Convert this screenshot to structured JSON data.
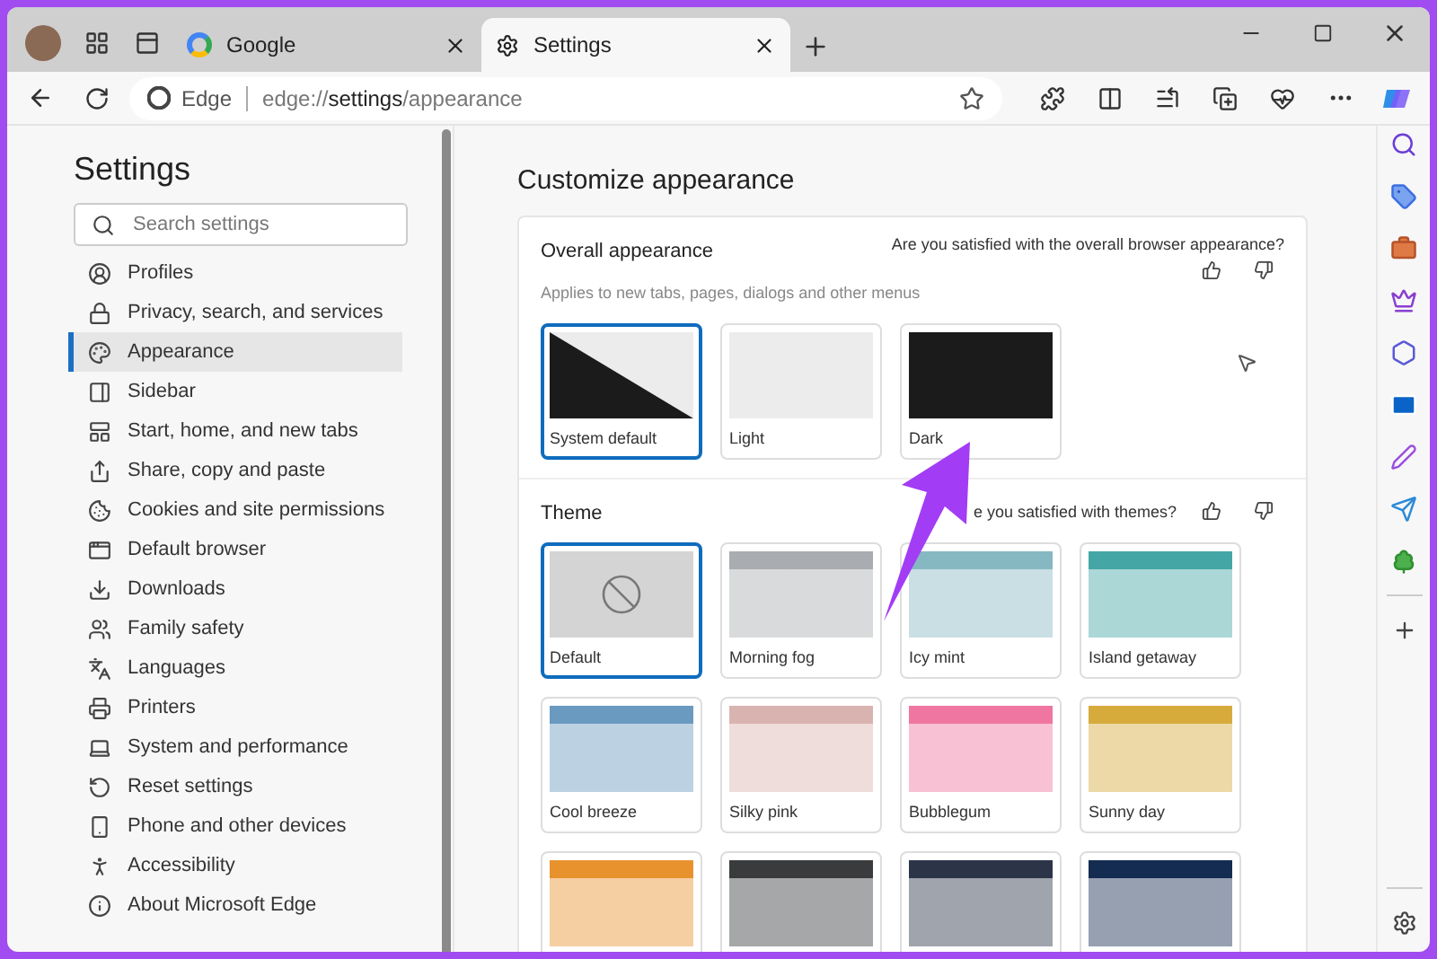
{
  "tabs": [
    {
      "label": "Google",
      "selected": false
    },
    {
      "label": "Settings",
      "selected": true
    }
  ],
  "address": {
    "site": "Edge",
    "url_prefix": "edge://",
    "url_main": "settings",
    "url_rest": "/appearance"
  },
  "sidebar": {
    "title": "Settings",
    "search": {
      "placeholder": "Search settings"
    },
    "items": [
      {
        "label": "Profiles",
        "selected": false
      },
      {
        "label": "Privacy, search, and services",
        "selected": false
      },
      {
        "label": "Appearance",
        "selected": true
      },
      {
        "label": "Sidebar",
        "selected": false
      },
      {
        "label": "Start, home, and new tabs",
        "selected": false
      },
      {
        "label": "Share, copy and paste",
        "selected": false
      },
      {
        "label": "Cookies and site permissions",
        "selected": false
      },
      {
        "label": "Default browser",
        "selected": false
      },
      {
        "label": "Downloads",
        "selected": false
      },
      {
        "label": "Family safety",
        "selected": false
      },
      {
        "label": "Languages",
        "selected": false
      },
      {
        "label": "Printers",
        "selected": false
      },
      {
        "label": "System and performance",
        "selected": false
      },
      {
        "label": "Reset settings",
        "selected": false
      },
      {
        "label": "Phone and other devices",
        "selected": false
      },
      {
        "label": "Accessibility",
        "selected": false
      },
      {
        "label": "About Microsoft Edge",
        "selected": false
      }
    ]
  },
  "main": {
    "title": "Customize appearance",
    "overall": {
      "title": "Overall appearance",
      "feedback": "Are you satisfied with the overall browser appearance?",
      "description": "Applies to new tabs, pages, dialogs and other menus",
      "options": [
        {
          "label": "System default",
          "kind": "system",
          "selected": true
        },
        {
          "label": "Light",
          "kind": "light",
          "selected": false
        },
        {
          "label": "Dark",
          "kind": "dark",
          "selected": false
        }
      ]
    },
    "theme": {
      "title": "Theme",
      "feedback": "e you satisfied with themes?",
      "themes": [
        {
          "label": "Default",
          "kind": "none",
          "selected": true
        },
        {
          "label": "Morning fog",
          "kind": "color",
          "color": "#a9acb0",
          "selected": false
        },
        {
          "label": "Icy mint",
          "kind": "color",
          "color": "#86b8c2",
          "selected": false
        },
        {
          "label": "Island getaway",
          "kind": "color",
          "color": "#45a6a6",
          "selected": false
        },
        {
          "label": "Cool breeze",
          "kind": "color",
          "color": "#6a9ac0",
          "selected": false
        },
        {
          "label": "Silky pink",
          "kind": "color",
          "color": "#d9b3b0",
          "selected": false
        },
        {
          "label": "Bubblegum",
          "kind": "color",
          "color": "#ef76a0",
          "selected": false
        },
        {
          "label": "Sunny day",
          "kind": "color",
          "color": "#d6ab3c",
          "selected": false
        },
        {
          "kind": "color",
          "color": "#e8922e",
          "selected": false
        },
        {
          "kind": "color",
          "color": "#3a3b3d",
          "selected": false
        },
        {
          "kind": "color",
          "color": "#2b3547",
          "selected": false
        },
        {
          "kind": "color",
          "color": "#152c52",
          "selected": false
        }
      ]
    }
  }
}
